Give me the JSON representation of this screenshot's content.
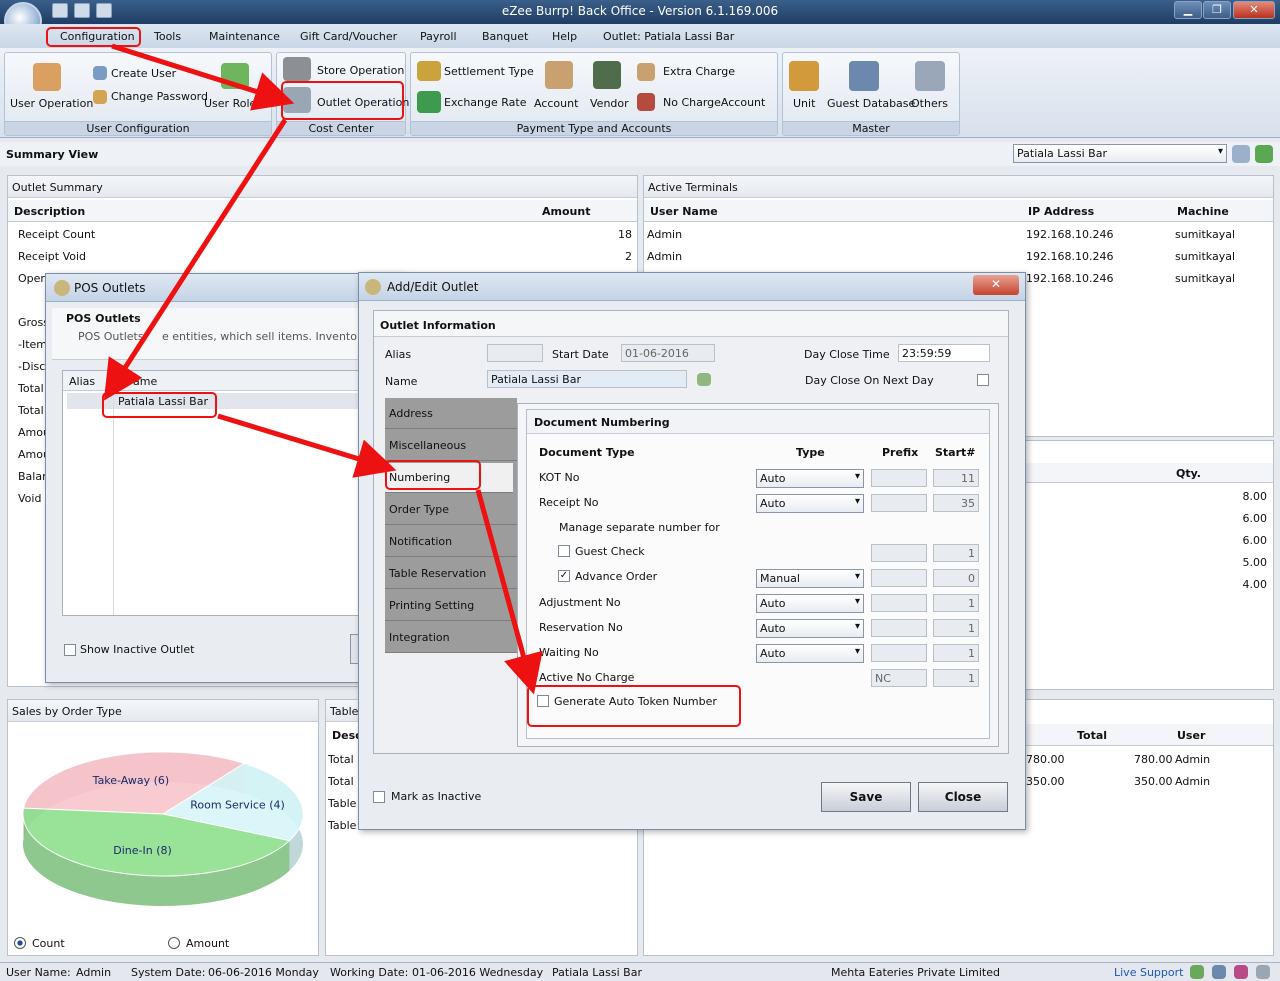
{
  "window": {
    "title": "eZee Burrp! Back Office - Version 6.1.169.006",
    "min": "▁",
    "max": "❐",
    "close": "✕"
  },
  "menu": [
    "Configuration",
    "Tools",
    "Maintenance",
    "Gift Card/Voucher",
    "Payroll",
    "Banquet",
    "Help",
    "Outlet: Patiala Lassi Bar"
  ],
  "ribbon": {
    "user_config": {
      "caption": "User Configuration",
      "user_operation": "User Operation",
      "create_user": "Create User",
      "change_password": "Change Password",
      "user_roles": "User Roles"
    },
    "cost_center": {
      "caption": "Cost Center",
      "store_operation": "Store Operation",
      "outlet_operation": "Outlet Operation"
    },
    "payment": {
      "caption": "Payment Type and Accounts",
      "settlement_type": "Settlement Type",
      "exchange_rate": "Exchange Rate",
      "account": "Account",
      "vendor": "Vendor",
      "extra_charge": "Extra Charge",
      "no_charge_account": "No ChargeAccount"
    },
    "master": {
      "caption": "Master",
      "unit": "Unit",
      "guest_database": "Guest Database",
      "others": "Others"
    }
  },
  "summary": {
    "title": "Summary View",
    "outlet_select": "Patiala Lassi Bar"
  },
  "outlet_summary": {
    "title": "Outlet Summary",
    "col_desc": "Description",
    "col_amount": "Amount",
    "rows": [
      {
        "d": "Receipt Count",
        "a": "18"
      },
      {
        "d": "Receipt Void",
        "a": "2"
      },
      {
        "d": "Oper",
        "a": ""
      },
      {
        "d": "Gross",
        "a": ""
      },
      {
        "d": "-Item",
        "a": ""
      },
      {
        "d": "-Disc",
        "a": ""
      },
      {
        "d": "Total",
        "a": ""
      },
      {
        "d": "Total",
        "a": ""
      },
      {
        "d": "Amou",
        "a": ""
      },
      {
        "d": "Amou",
        "a": ""
      },
      {
        "d": "Balan",
        "a": ""
      },
      {
        "d": "Void",
        "a": ""
      }
    ]
  },
  "active_terminals": {
    "title": "Active Terminals",
    "col_user": "User Name",
    "col_ip": "IP Address",
    "col_machine": "Machine",
    "rows": [
      {
        "u": "Admin",
        "ip": "192.168.10.246",
        "m": "sumitkayal"
      },
      {
        "u": "Admin",
        "ip": "192.168.10.246",
        "m": "sumitkayal"
      },
      {
        "u": "",
        "ip": "192.168.10.246",
        "m": "sumitkayal"
      }
    ]
  },
  "qty_panel": {
    "col": "Qty.",
    "values": [
      "8.00",
      "6.00",
      "6.00",
      "5.00",
      "4.00"
    ]
  },
  "sales_order_type": {
    "title": "Sales by Order Type",
    "count": "Count",
    "amount": "Amount"
  },
  "chart_data": {
    "type": "pie",
    "title": "Sales by Order Type",
    "categories": [
      "Take-Away",
      "Room Service",
      "Dine-In"
    ],
    "labels": [
      "Take-Away (6)",
      "Room Service (4)",
      "Dine-In (8)"
    ],
    "values": [
      6,
      4,
      8
    ],
    "colors": [
      "#f7c6cc",
      "#d6f6f8",
      "#8fe08f"
    ]
  },
  "table_panel": {
    "title": "Table",
    "col_desc": "Desc",
    "rows": [
      "Total",
      "Total",
      "Table",
      "Table"
    ]
  },
  "bottom_right": {
    "col_total": "Total",
    "col_user": "User",
    "rows": [
      {
        "a": "780.00",
        "t": "780.00",
        "u": "Admin"
      },
      {
        "a": "350.00",
        "t": "350.00",
        "u": "Admin"
      }
    ]
  },
  "pos_outlets": {
    "title": "POS Outlets",
    "heading": "POS Outlets",
    "desc_a": "POS Outlets",
    "desc_b": "e entities, which sell items. Inventory of re",
    "col_alias": "Alias",
    "col_name": "ame",
    "row": "Patiala Lassi Bar",
    "show_inactive": "Show Inactive Outlet"
  },
  "edit_outlet": {
    "title": "Add/Edit Outlet",
    "section": "Outlet Information",
    "alias_label": "Alias",
    "alias_value": "",
    "start_date_label": "Start Date",
    "start_date": "01-06-2016",
    "day_close_time_label": "Day Close Time",
    "day_close_time": "23:59:59",
    "name_label": "Name",
    "name_value": "Patiala Lassi Bar",
    "day_close_next_label": "Day Close On Next Day",
    "tabs": [
      "Address",
      "Miscellaneous",
      "Numbering",
      "Order Type",
      "Notification",
      "Table Reservation",
      "Printing Setting",
      "Integration"
    ],
    "doc": {
      "title": "Document Numbering",
      "col_type": "Document Type",
      "col_kind": "Type",
      "col_prefix": "Prefix",
      "col_start": "Start#",
      "kot": "KOT No",
      "kot_type": "Auto",
      "kot_start": "11",
      "receipt": "Receipt No",
      "receipt_type": "Auto",
      "receipt_start": "35",
      "manage": "Manage separate number for",
      "guest": "Guest Check",
      "guest_start": "1",
      "advance": "Advance Order",
      "advance_type": "Manual",
      "advance_start": "0",
      "adjust": "Adjustment No",
      "adjust_type": "Auto",
      "adjust_start": "1",
      "reserve": "Reservation No",
      "reserve_type": "Auto",
      "reserve_start": "1",
      "waiting": "Waiting No",
      "waiting_type": "Auto",
      "waiting_start": "1",
      "nocharge": "Active No Charge",
      "nocharge_prefix": "NC",
      "nocharge_start": "1",
      "token": "Generate Auto Token Number"
    },
    "inactive": "Mark as Inactive",
    "save": "Save",
    "close": "Close"
  },
  "status": {
    "user_label": "User Name:",
    "user": "Admin",
    "sys_label": "System Date:",
    "sys": "06-06-2016 Monday",
    "work_label": "Working Date:",
    "work": "01-06-2016 Wednesday",
    "outlet": "Patiala Lassi Bar",
    "company": "Mehta Eateries Private Limited",
    "live": "Live Support"
  }
}
